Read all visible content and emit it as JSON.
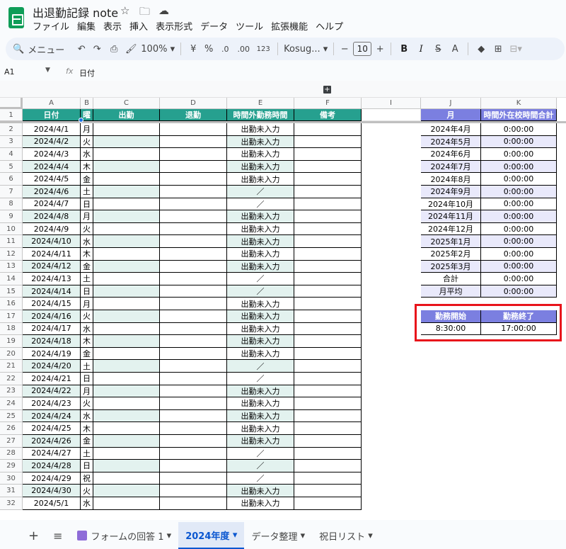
{
  "title": "出退勤記録 note",
  "menu": [
    "ファイル",
    "編集",
    "表示",
    "挿入",
    "表示形式",
    "データ",
    "ツール",
    "拡張機能",
    "ヘルプ"
  ],
  "toolbar": {
    "search_label": "メニュー",
    "zoom": "100%",
    "currency": "¥",
    "percent": "%",
    "dec_decrease": ".0",
    "dec_increase": ".00",
    "number_format": "123",
    "font": "Kosug...",
    "font_size": "10"
  },
  "formula_bar": {
    "cell_ref": "A1",
    "content": "日付"
  },
  "columns": [
    "A",
    "B",
    "C",
    "D",
    "E",
    "F",
    "I",
    "J",
    "K"
  ],
  "headers": {
    "a": "日付",
    "b": "曜",
    "c": "出勤",
    "d": "退勤",
    "e": "時間外勤務時間",
    "f": "備考",
    "j": "月",
    "k": "時間外在校時間合計"
  },
  "rows": [
    {
      "n": "2",
      "date": "2024/4/1",
      "dow": "月",
      "e": "出勤未入力"
    },
    {
      "n": "3",
      "date": "2024/4/2",
      "dow": "火",
      "e": "出勤未入力"
    },
    {
      "n": "4",
      "date": "2024/4/3",
      "dow": "水",
      "e": "出勤未入力"
    },
    {
      "n": "5",
      "date": "2024/4/4",
      "dow": "木",
      "e": "出勤未入力"
    },
    {
      "n": "6",
      "date": "2024/4/5",
      "dow": "金",
      "e": "出勤未入力"
    },
    {
      "n": "7",
      "date": "2024/4/6",
      "dow": "土",
      "e": "／"
    },
    {
      "n": "8",
      "date": "2024/4/7",
      "dow": "日",
      "e": "／"
    },
    {
      "n": "9",
      "date": "2024/4/8",
      "dow": "月",
      "e": "出勤未入力"
    },
    {
      "n": "10",
      "date": "2024/4/9",
      "dow": "火",
      "e": "出勤未入力"
    },
    {
      "n": "11",
      "date": "2024/4/10",
      "dow": "水",
      "e": "出勤未入力"
    },
    {
      "n": "12",
      "date": "2024/4/11",
      "dow": "木",
      "e": "出勤未入力"
    },
    {
      "n": "13",
      "date": "2024/4/12",
      "dow": "金",
      "e": "出勤未入力"
    },
    {
      "n": "14",
      "date": "2024/4/13",
      "dow": "土",
      "e": "／"
    },
    {
      "n": "15",
      "date": "2024/4/14",
      "dow": "日",
      "e": "／"
    },
    {
      "n": "16",
      "date": "2024/4/15",
      "dow": "月",
      "e": "出勤未入力"
    },
    {
      "n": "17",
      "date": "2024/4/16",
      "dow": "火",
      "e": "出勤未入力"
    },
    {
      "n": "18",
      "date": "2024/4/17",
      "dow": "水",
      "e": "出勤未入力"
    },
    {
      "n": "19",
      "date": "2024/4/18",
      "dow": "木",
      "e": "出勤未入力"
    },
    {
      "n": "20",
      "date": "2024/4/19",
      "dow": "金",
      "e": "出勤未入力"
    },
    {
      "n": "21",
      "date": "2024/4/20",
      "dow": "土",
      "e": "／"
    },
    {
      "n": "22",
      "date": "2024/4/21",
      "dow": "日",
      "e": "／"
    },
    {
      "n": "23",
      "date": "2024/4/22",
      "dow": "月",
      "e": "出勤未入力"
    },
    {
      "n": "24",
      "date": "2024/4/23",
      "dow": "火",
      "e": "出勤未入力"
    },
    {
      "n": "25",
      "date": "2024/4/24",
      "dow": "水",
      "e": "出勤未入力"
    },
    {
      "n": "26",
      "date": "2024/4/25",
      "dow": "木",
      "e": "出勤未入力"
    },
    {
      "n": "27",
      "date": "2024/4/26",
      "dow": "金",
      "e": "出勤未入力"
    },
    {
      "n": "28",
      "date": "2024/4/27",
      "dow": "土",
      "e": "／"
    },
    {
      "n": "29",
      "date": "2024/4/28",
      "dow": "日",
      "e": "／"
    },
    {
      "n": "30",
      "date": "2024/4/29",
      "dow": "祝",
      "e": "／"
    },
    {
      "n": "31",
      "date": "2024/4/30",
      "dow": "火",
      "e": "出勤未入力"
    },
    {
      "n": "32",
      "date": "2024/5/1",
      "dow": "水",
      "e": "出勤未入力"
    }
  ],
  "summary": [
    {
      "month": "2024年4月",
      "total": "0:00:00"
    },
    {
      "month": "2024年5月",
      "total": "0:00:00"
    },
    {
      "month": "2024年6月",
      "total": "0:00:00"
    },
    {
      "month": "2024年7月",
      "total": "0:00:00"
    },
    {
      "month": "2024年8月",
      "total": "0:00:00"
    },
    {
      "month": "2024年9月",
      "total": "0:00:00"
    },
    {
      "month": "2024年10月",
      "total": "0:00:00"
    },
    {
      "month": "2024年11月",
      "total": "0:00:00"
    },
    {
      "month": "2024年12月",
      "total": "0:00:00"
    },
    {
      "month": "2025年1月",
      "total": "0:00:00"
    },
    {
      "month": "2025年2月",
      "total": "0:00:00"
    },
    {
      "month": "2025年3月",
      "total": "0:00:00"
    },
    {
      "month": "合計",
      "total": "0:00:00"
    },
    {
      "month": "月平均",
      "total": "0:00:00"
    }
  ],
  "work_hours": {
    "start_label": "勤務開始",
    "end_label": "勤務終了",
    "start": "8:30:00",
    "end": "17:00:00"
  },
  "tabs": [
    {
      "label": "フォームの回答 1",
      "active": false
    },
    {
      "label": "2024年度",
      "active": true
    },
    {
      "label": "データ整理",
      "active": false
    },
    {
      "label": "祝日リスト",
      "active": false
    }
  ],
  "colors": {
    "header_teal": "#26a08f",
    "header_purple": "#7b7fe0",
    "highlight_red": "#e8141b"
  }
}
